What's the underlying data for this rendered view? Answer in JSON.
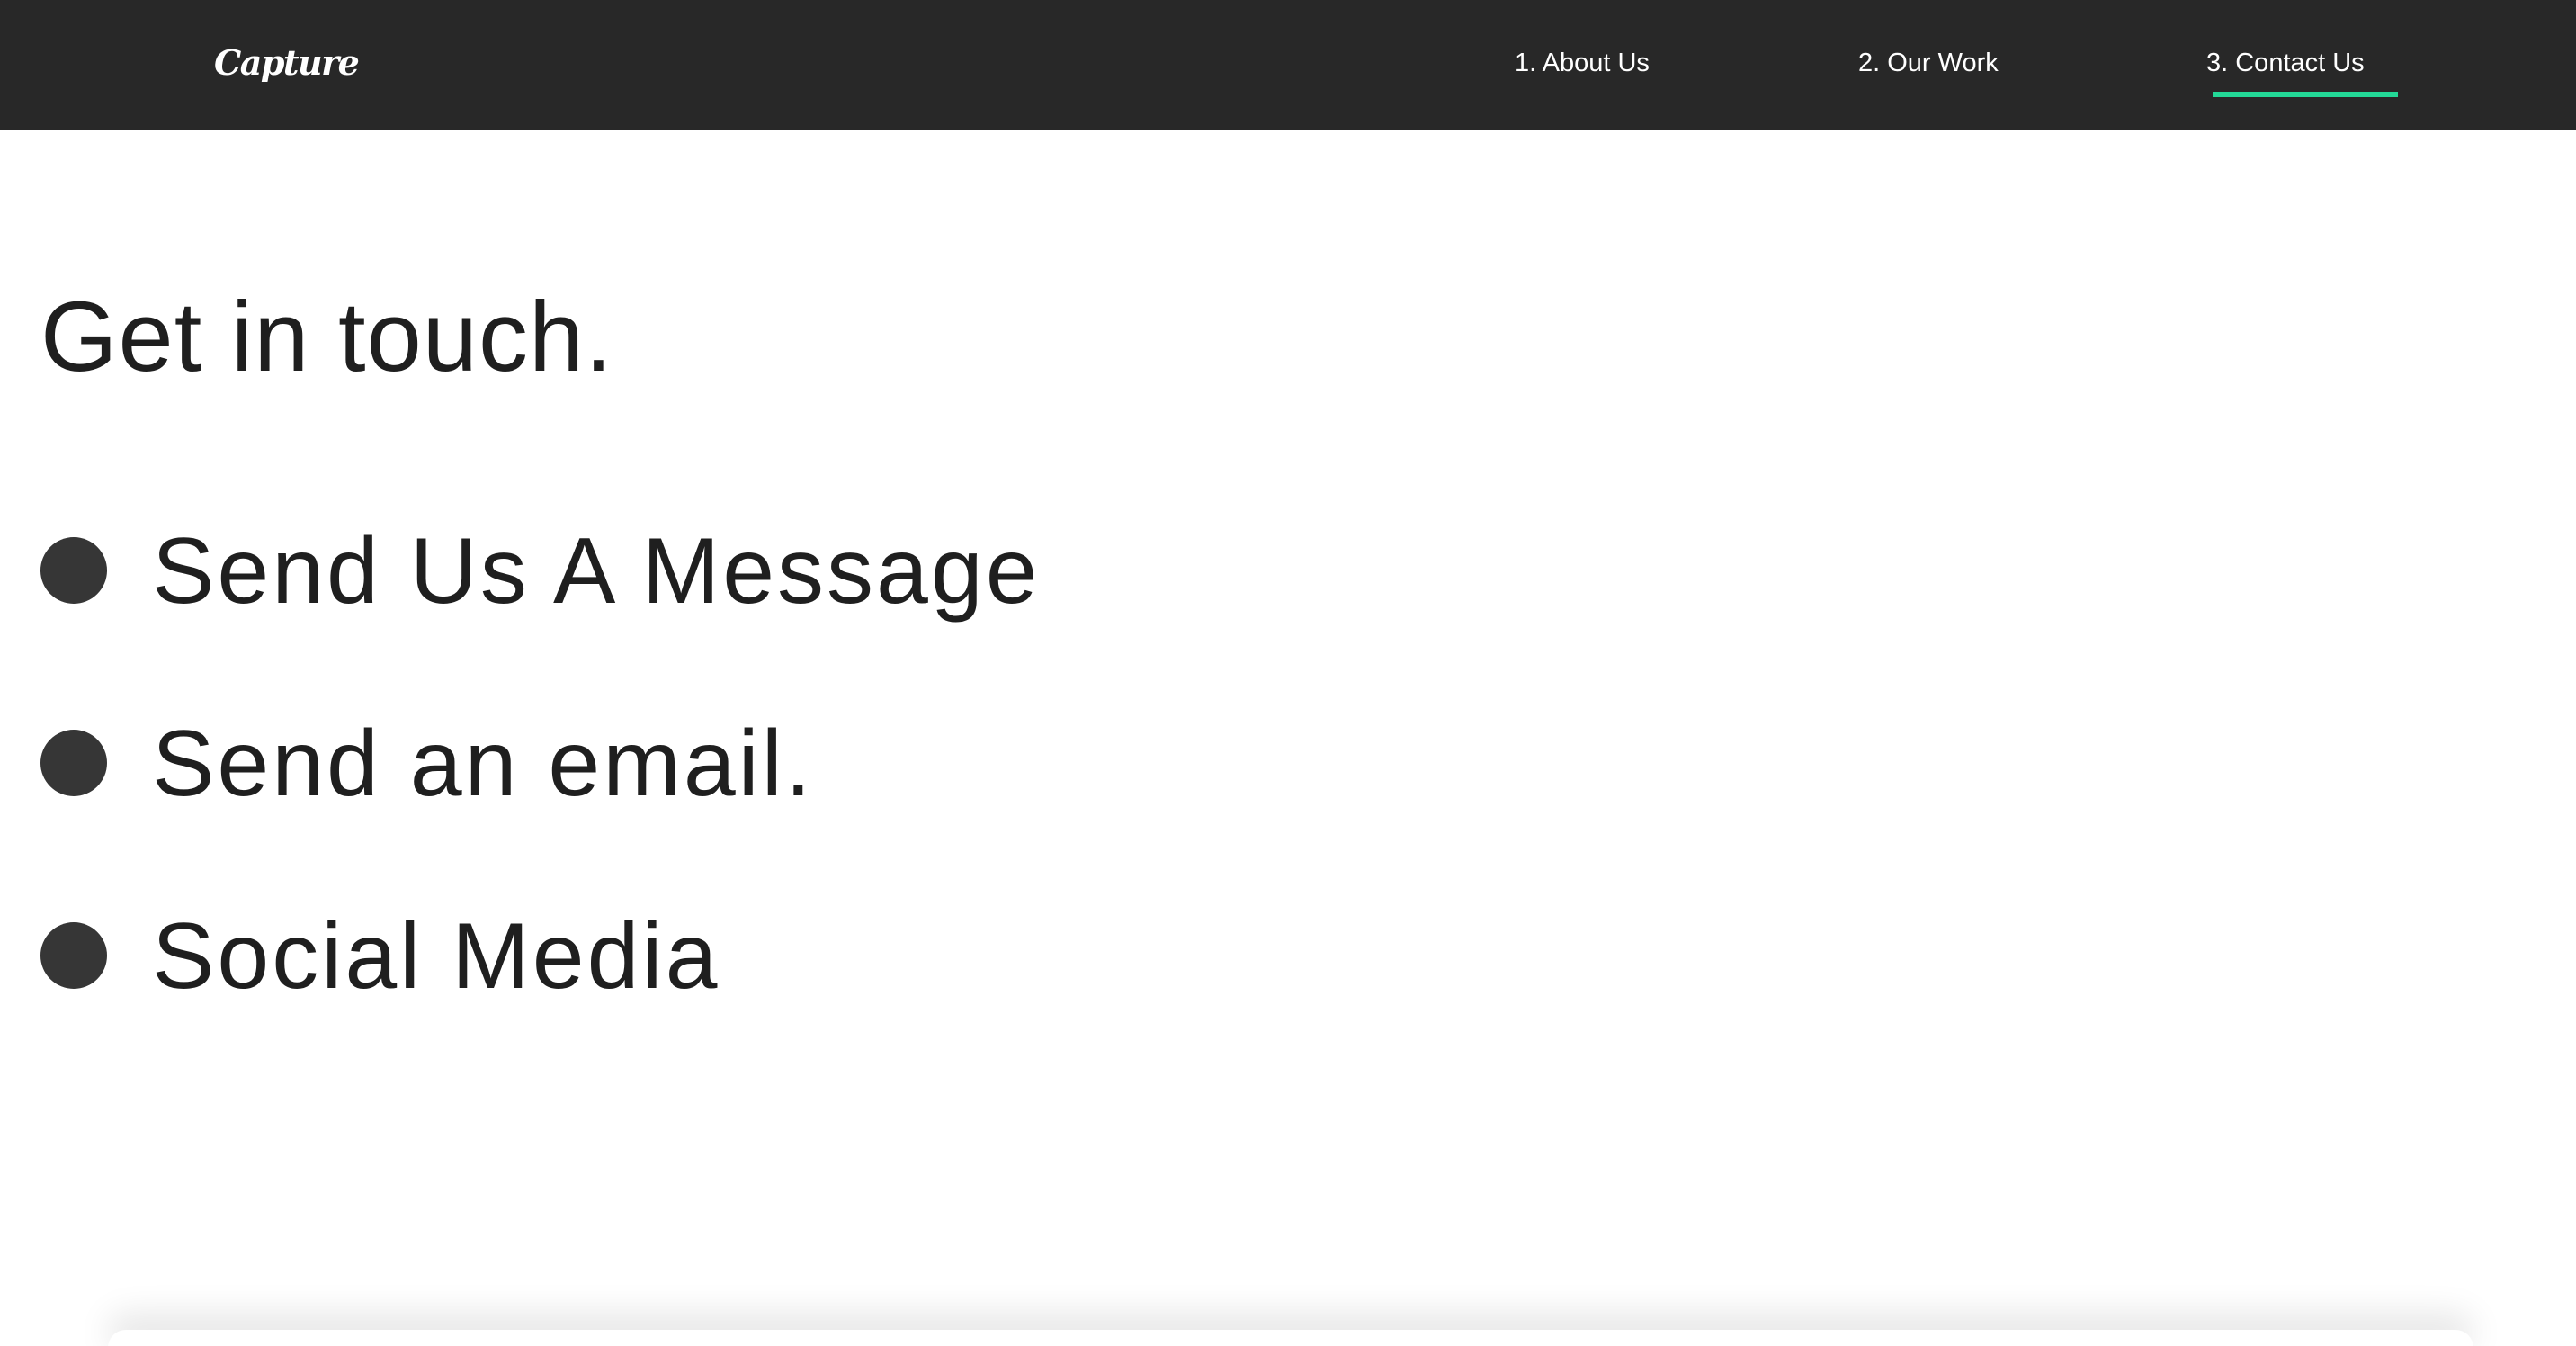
{
  "header": {
    "logo_text": "Capture",
    "nav_items": [
      {
        "label": "1. About Us",
        "active": false
      },
      {
        "label": "2. Our Work",
        "active": false
      },
      {
        "label": "3. Contact Us",
        "active": true
      }
    ]
  },
  "main": {
    "heading": "Get in touch.",
    "contact_options": [
      {
        "label": "Send Us A Message"
      },
      {
        "label": "Send an email."
      },
      {
        "label": "Social Media"
      }
    ]
  },
  "colors": {
    "navbar_background": "#282828",
    "active_underline": "#23d997",
    "bullet": "#363636",
    "text": "#1f1f1f",
    "page_background": "#ffffff"
  }
}
